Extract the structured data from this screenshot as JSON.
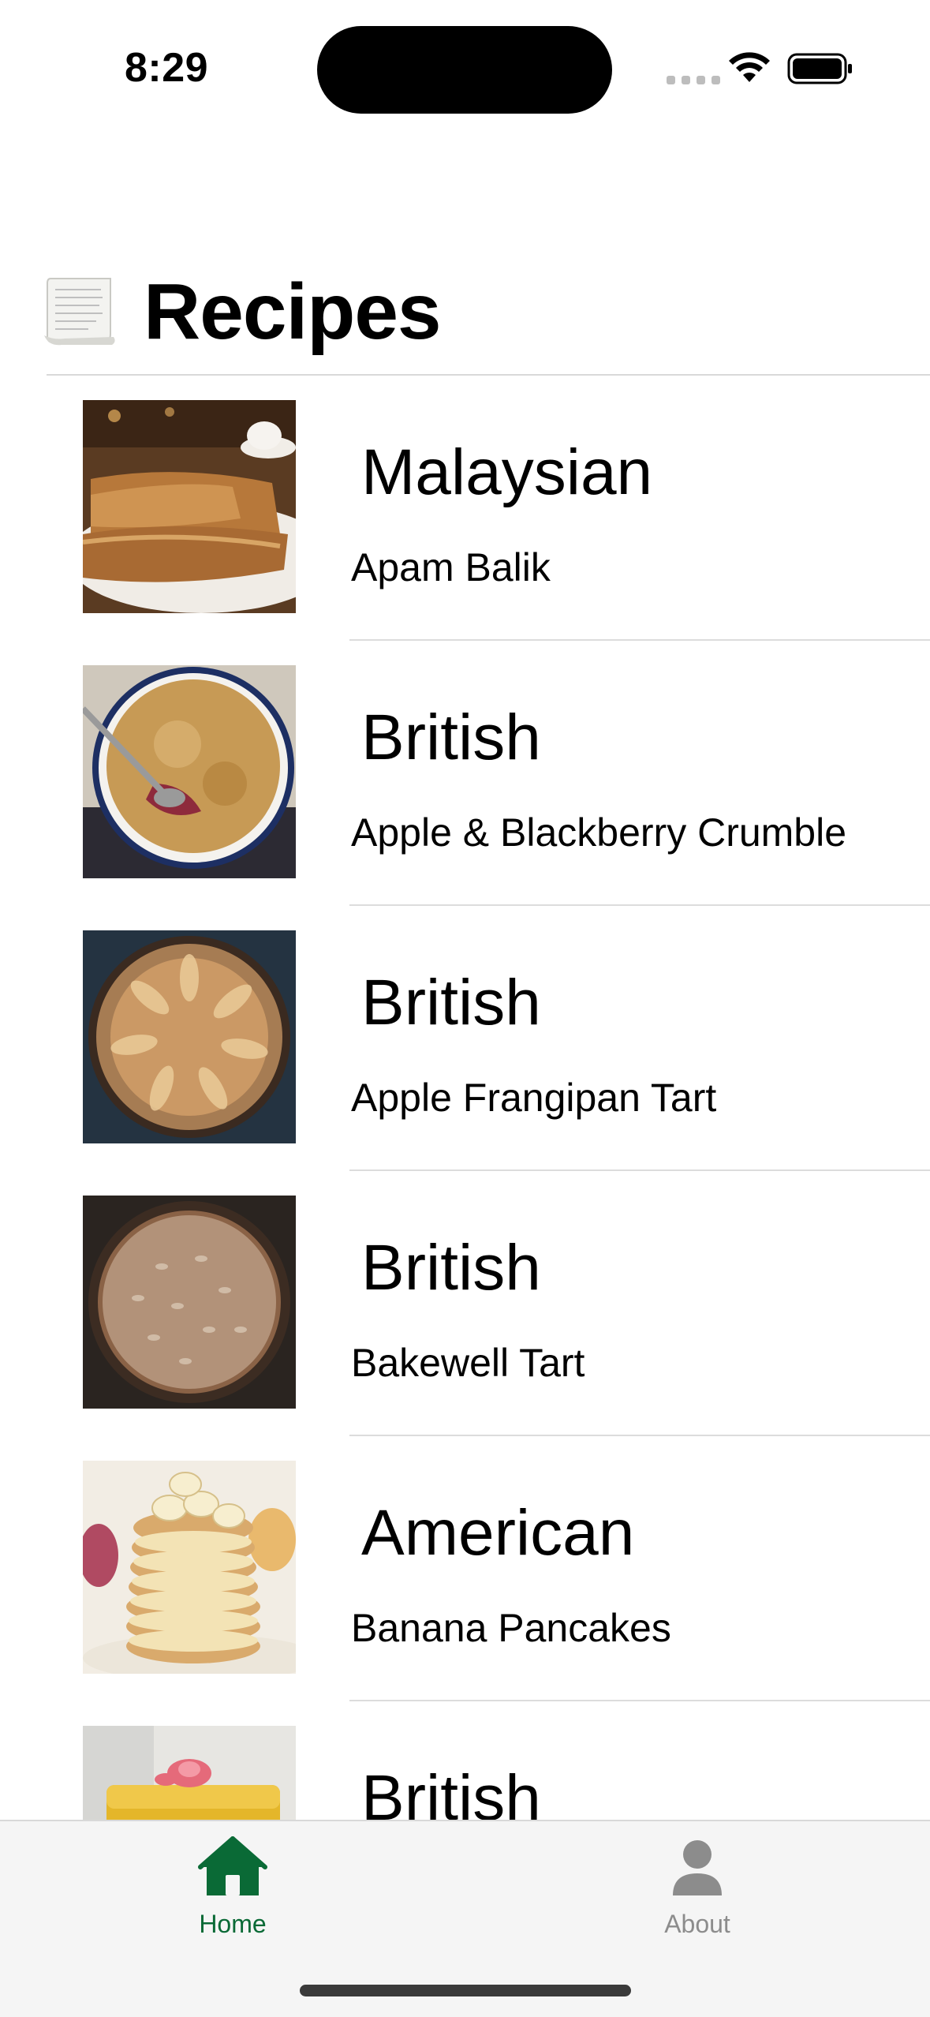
{
  "status_bar": {
    "time": "8:29",
    "icons": [
      "cellular-signal-icon",
      "wifi-icon",
      "battery-icon"
    ]
  },
  "header": {
    "title": "Recipes",
    "icon": "scroll-emoji-icon"
  },
  "recipes": [
    {
      "cuisine": "Malaysian",
      "name": "Apam Balik",
      "image": "apam-balik-photo"
    },
    {
      "cuisine": "British",
      "name": "Apple & Blackberry Crumble",
      "image": "crumble-photo"
    },
    {
      "cuisine": "British",
      "name": "Apple Frangipan Tart",
      "image": "frangipan-tart-photo"
    },
    {
      "cuisine": "British",
      "name": "Bakewell Tart",
      "image": "bakewell-tart-photo"
    },
    {
      "cuisine": "American",
      "name": "Banana Pancakes",
      "image": "banana-pancakes-photo"
    },
    {
      "cuisine": "British",
      "name": "",
      "image": "yellow-cake-photo"
    }
  ],
  "tab_bar": {
    "active_color": "#0a6a36",
    "inactive_color": "#8c8c8c",
    "tabs": [
      {
        "label": "Home",
        "icon": "house-icon",
        "active": true
      },
      {
        "label": "About",
        "icon": "person-icon",
        "active": false
      }
    ]
  }
}
